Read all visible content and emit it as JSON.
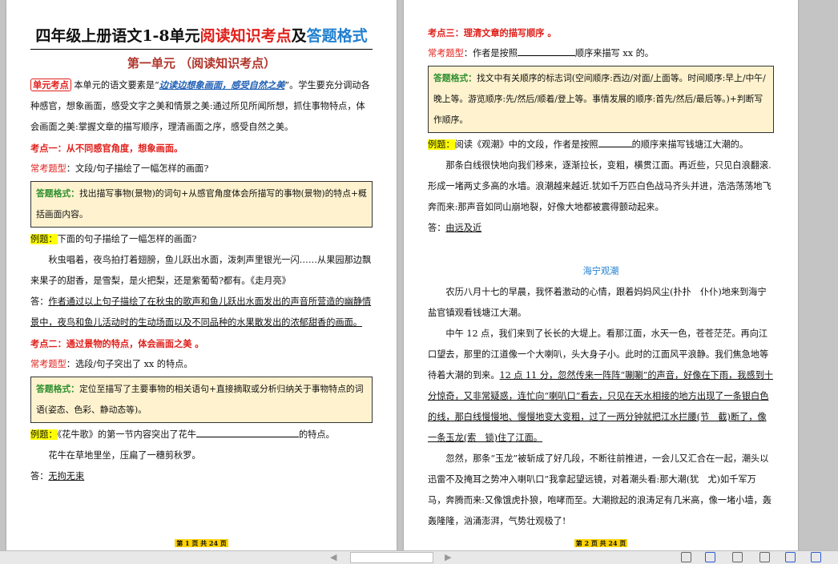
{
  "page1": {
    "title_part1": "四年级上册语文1-8单元",
    "title_part2": "阅读知识考点",
    "title_part3": "及",
    "title_part4": "答题格式",
    "unit_title": "第一单元 （阅读知识考点）",
    "unit_tag": "单元考点",
    "unit_text_a": "本单元的语文要素是“",
    "unit_text_key": "边读边想象画面，感受自然之美",
    "unit_text_b": "”。学生要充分调动各种感官，想象画面，感受文字之美和情景之美:通过所见所闻所想，抓住事物特点，体会画面之美:掌握文章的描写顺序，理清画面之序，感受自然之美。",
    "kp1_title": "考点一：从不同感官角度，想象画面。",
    "kp1_common_label": "常考题型",
    "kp1_common_text": "：文段/句子描绘了一幅怎样的画面?",
    "kp1_answer_label": "答题格式：",
    "kp1_answer_text": "找出描写事物(景物)的词句+从感官角度体会所描写的事物(景物)的特点+概括画面内容。",
    "kp1_example_label": "例题：",
    "kp1_example_text": "下面的句子描绘了一幅怎样的画面?",
    "kp1_passage": "秋虫唱着，夜鸟拍打着翅膀，鱼儿跃出水面，泼刺声里银光一闪……从果园那边飘来果子的甜香，是雪梨，是火把梨，还是紫葡萄?都有。《走月亮》",
    "kp1_answer_prefix": "答：",
    "kp1_answer": "作者通过以上句子描绘了在秋虫的歌声和鱼儿跃出水面发出的声音所营造的幽静情景中，夜鸟和鱼儿活动时的生动场面以及不同品种的水果散发出的浓郁甜香的画面。",
    "kp2_title": "考点二：通过景物的特点，体会画面之美 。",
    "kp2_common_label": "常考题型",
    "kp2_common_text": "：选段/句子突出了 xx 的特点。",
    "kp2_answer_label": "答题格式：",
    "kp2_answer_text": "定位至描写了主要事物的相关语句+直接摘取或分析归纳关于事物特点的词语(姿态、色彩、静动态等)。",
    "kp2_example_label": "例题：",
    "kp2_example_a": "《花牛歌》的第一节内容突出了花牛",
    "kp2_example_b": "的特点。",
    "kp2_passage": "花牛在草地里坐，压扁了一穗剪秋罗。",
    "kp2_answer_prefix": "答：",
    "kp2_answer": "无拘无束",
    "footer": "第 1 页 共 24 页"
  },
  "page2": {
    "kp3_title": "考点三：理清文章的描写顺序 。",
    "kp3_common_label": "常考题型",
    "kp3_common_a": "：作者是按照",
    "kp3_common_b": "顺序来描写 xx 的。",
    "kp3_answer_label": "答题格式：",
    "kp3_answer_text": "找文中有关顺序的标志词(空间顺序:西边/对面/上面等。时间顺序:早上/中午/晚上等。游览顺序:先/然后/顺着/登上等。事情发展的顺序:首先/然后/最后等。)+判断写作顺序。",
    "kp3_example_label": "例题：",
    "kp3_example_a": "阅读《观潮》中的文段，作者是按照",
    "kp3_example_b": "的顺序来描写钱塘江大潮的。",
    "kp3_passage": "那条白线很快地向我们移来，逐渐拉长，变粗，横贯江面。再近些，只见白浪翻滚.形成一堵两丈多高的水墙。浪潮越来越近.犹如千万匹白色战马齐头并进，浩浩荡荡地飞奔而来:那声音如同山崩地裂，好像大地都被震得颤动起来。",
    "kp3_answer_prefix": "答：",
    "kp3_answer": "由远及近",
    "essay_title": "海宁观潮",
    "essay_p1": "农历八月十七的早晨，我怀着激动的心情，跟着妈妈风尘(扑扑　仆仆)地来到海宁盐官镇观看钱塘江大潮。",
    "essay_p2_a": "中午 12 点，我们来到了长长的大堤上。看那江面，水天一色，苍苍茫茫。再向江口望去，那里的江道像一个大喇叭，头大身子小。此时的江面风平浪静。我们焦急地等待着大潮的到来。",
    "essay_p2_ul": "12 点 11 分，忽然传来一阵阵“唰唰”的声音，好像在下雨，我感到十分惊奇，又非常疑惑，连忙向“喇叭口”看去，只见在天水相接的地方出现了一条银白色的线，那白线慢慢地、慢慢地变大变粗，过了一两分钟就把江水拦腰(节　截)断了，像一条玉龙(索　锁)住了江面。",
    "essay_p3": "忽然，那条“玉龙”被斩成了好几段，不断往前推进，一会儿又汇合在一起，潮头以迅雷不及掩耳之势冲入喇叭口”我拿起望远镜，对着潮头看:那大潮(犹　尤)如千军万马，奔腾而来:又像饿虎扑狼，咆哮而至。大潮掀起的浪涛足有几米高，像一堵小墙，轰轰隆隆，汹涌澎湃，气势壮观极了!",
    "footer": "第 2 页 共 24 页"
  },
  "colors": {
    "red": "#e0201b",
    "blue": "#1f7fd0",
    "answer_bg": "#fff3cf",
    "highlight": "#ffff00"
  }
}
